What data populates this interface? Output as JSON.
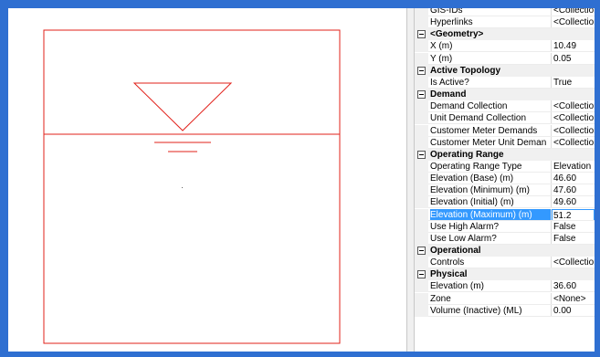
{
  "colors": {
    "frame": "#2f6fd1",
    "drawing_line": "#e2201a",
    "selection": "#3399ff",
    "category_bg": "#f0f0f0"
  },
  "drawing": {
    "symbol": "tank-water-level"
  },
  "properties": {
    "rows": [
      {
        "kind": "prop",
        "name": "GIS-IDs",
        "value": "<Collection"
      },
      {
        "kind": "prop",
        "name": "Hyperlinks",
        "value": "<Collection"
      },
      {
        "kind": "cat",
        "name": "<Geometry>"
      },
      {
        "kind": "prop",
        "name": "X (m)",
        "value": "10.49"
      },
      {
        "kind": "prop",
        "name": "Y (m)",
        "value": "0.05"
      },
      {
        "kind": "cat",
        "name": "Active Topology"
      },
      {
        "kind": "prop",
        "name": "Is Active?",
        "value": "True"
      },
      {
        "kind": "cat",
        "name": "Demand"
      },
      {
        "kind": "prop",
        "name": "Demand Collection",
        "value": "<Collection"
      },
      {
        "kind": "prop",
        "name": "Unit Demand Collection",
        "value": "<Collection"
      },
      {
        "kind": "prop",
        "name": "Customer Meter Demands",
        "value": "<Collection"
      },
      {
        "kind": "prop",
        "name": "Customer Meter Unit Deman",
        "value": "<Collection"
      },
      {
        "kind": "cat",
        "name": "Operating Range"
      },
      {
        "kind": "prop",
        "name": "Operating Range Type",
        "value": "Elevation"
      },
      {
        "kind": "prop",
        "name": "Elevation (Base) (m)",
        "value": "46.60"
      },
      {
        "kind": "prop",
        "name": "Elevation (Minimum) (m)",
        "value": "47.60"
      },
      {
        "kind": "prop",
        "name": "Elevation (Initial) (m)",
        "value": "49.60"
      },
      {
        "kind": "prop",
        "name": "Elevation (Maximum) (m)",
        "value": "51.2",
        "selected": true
      },
      {
        "kind": "prop",
        "name": "Use High Alarm?",
        "value": "False"
      },
      {
        "kind": "prop",
        "name": "Use Low Alarm?",
        "value": "False"
      },
      {
        "kind": "cat",
        "name": "Operational"
      },
      {
        "kind": "prop",
        "name": "Controls",
        "value": "<Collection"
      },
      {
        "kind": "cat",
        "name": "Physical"
      },
      {
        "kind": "prop",
        "name": "Elevation (m)",
        "value": "36.60"
      },
      {
        "kind": "prop",
        "name": "Zone",
        "value": "<None>"
      },
      {
        "kind": "prop",
        "name": "Volume (Inactive) (ML)",
        "value": "0.00"
      }
    ]
  }
}
